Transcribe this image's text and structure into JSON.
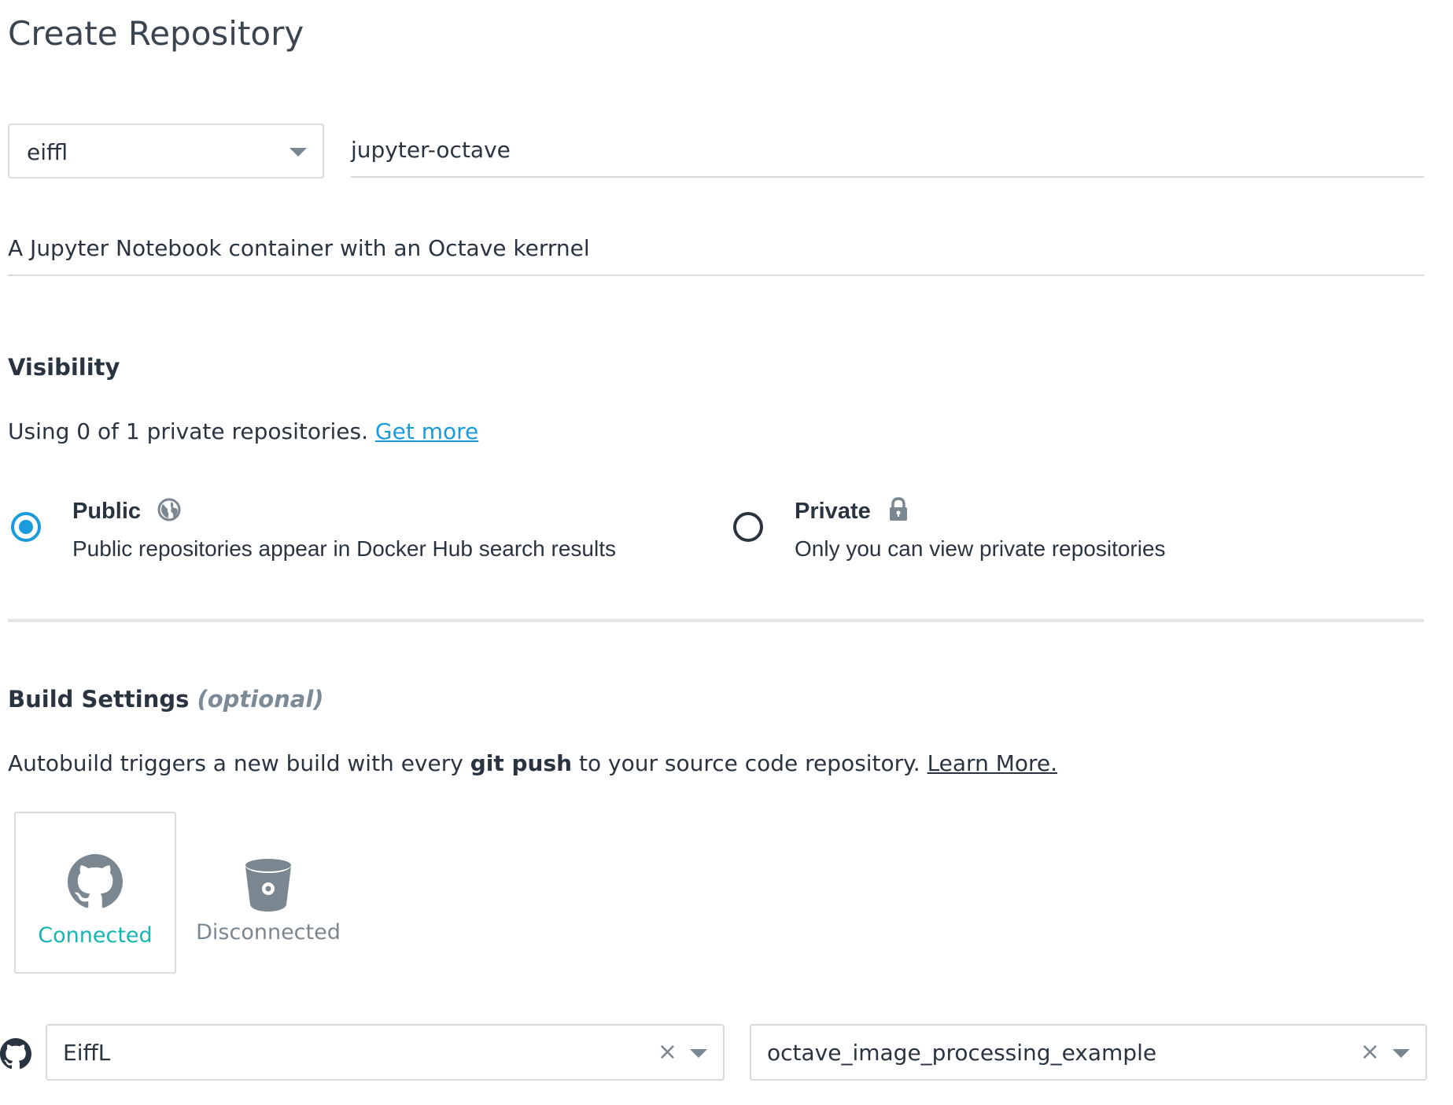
{
  "page": {
    "title": "Create Repository"
  },
  "form": {
    "namespace_value": "eiffl",
    "name_value": "jupyter-octave",
    "description_value": "A Jupyter Notebook container with an Octave kerrnel"
  },
  "visibility": {
    "heading": "Visibility",
    "usage_text": "Using 0 of 1 private repositories.",
    "get_more_link": "Get more",
    "public": {
      "title": "Public",
      "description": "Public repositories appear in Docker Hub search results",
      "icon": "globe-icon",
      "selected": true
    },
    "private": {
      "title": "Private",
      "description": "Only you can view private repositories",
      "icon": "lock-icon",
      "selected": false
    }
  },
  "build_settings": {
    "heading": "Build Settings",
    "optional_label": "(optional)",
    "desc_prefix": "Autobuild triggers a new build with every",
    "desc_bold": "git push",
    "desc_suffix": "to your source code repository.",
    "learn_more_link": "Learn More.",
    "providers": [
      {
        "icon": "github-icon",
        "status": "Connected"
      },
      {
        "icon": "bitbucket-icon",
        "status": "Disconnected"
      }
    ],
    "source_icon": "github-icon",
    "organization_value": "EiffL",
    "repository_value": "octave_image_processing_example",
    "clear_symbol": "×"
  },
  "colors": {
    "accent_blue": "#1a9bdb",
    "connected_teal": "#17b6b2",
    "text_dark": "#2a3440",
    "muted_gray": "#7b8790",
    "border_gray": "#d7dbde"
  }
}
